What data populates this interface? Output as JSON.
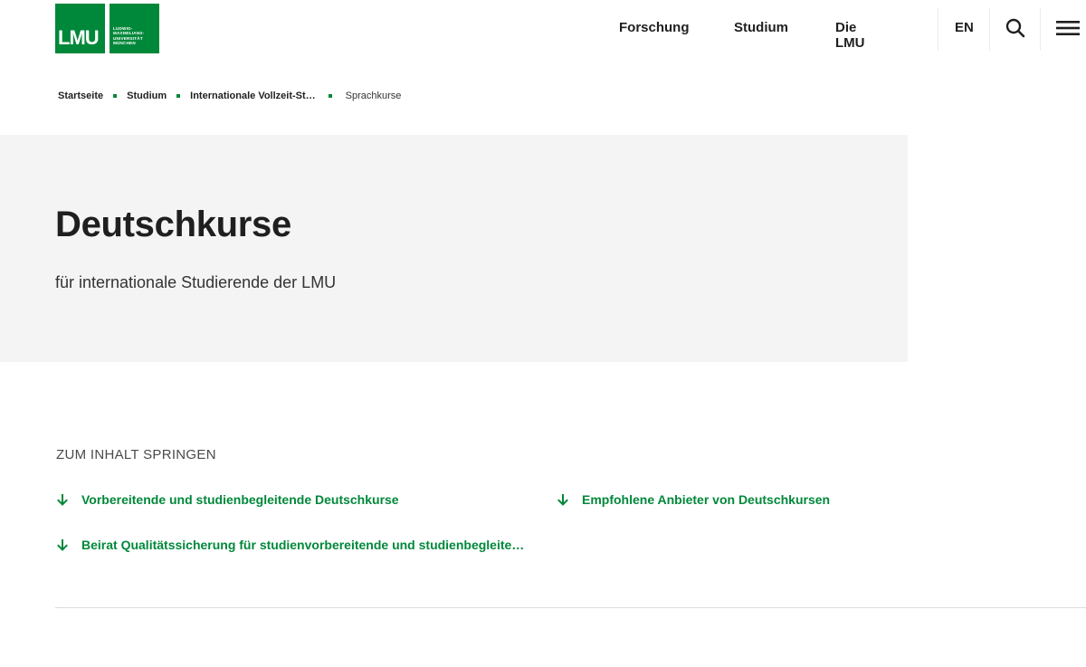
{
  "logo": {
    "mark": "LMU",
    "text_lines": [
      "LUDWIG-",
      "MAXIMILIANS-",
      "UNIVERSITÄT",
      "MÜNCHEN"
    ]
  },
  "nav": {
    "items": [
      {
        "label": "Forschung"
      },
      {
        "label": "Studium"
      },
      {
        "label": "Die LMU"
      }
    ],
    "language": "EN",
    "search_icon": "search-icon",
    "menu_icon": "hamburger-menu-icon"
  },
  "breadcrumb": {
    "items": [
      {
        "label": "Startseite"
      },
      {
        "label": "Studium"
      },
      {
        "label": "Internationale Vollzeit-St…"
      },
      {
        "label": "Sprachkurse"
      }
    ]
  },
  "hero": {
    "title": "Deutschkurse",
    "subtitle": "für internationale Studierende der LMU"
  },
  "jump": {
    "heading": "ZUM INHALT SPRINGEN",
    "links": [
      {
        "label": "Vorbereitende und studienbegleitende Deutschkurse"
      },
      {
        "label": "Empfohlene Anbieter von Deutschkursen"
      },
      {
        "label": "Beirat Qualitätssicherung für studienvorbereitende und studienbegleite…"
      }
    ]
  },
  "colors": {
    "brand_green": "#00883a",
    "hero_background": "#f4f4f4"
  }
}
